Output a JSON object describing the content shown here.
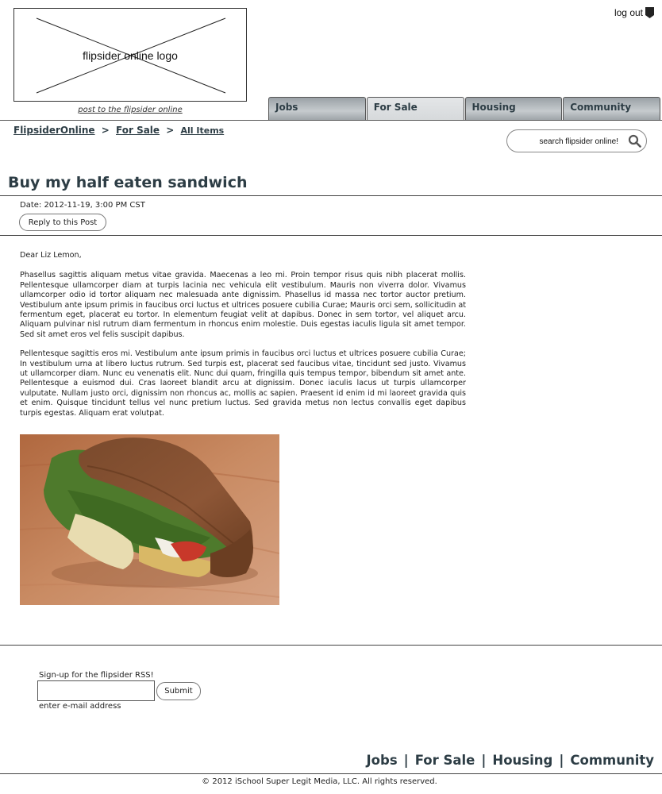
{
  "header": {
    "logo_text": "flipsider online logo",
    "logo_link": "post to the flipsider online",
    "logout_label": "log out"
  },
  "tabs": [
    {
      "label": "Jobs",
      "active": false
    },
    {
      "label": "For Sale",
      "active": true
    },
    {
      "label": "Housing",
      "active": false
    },
    {
      "label": "Community",
      "active": false
    }
  ],
  "breadcrumb": {
    "items": [
      "FlipsiderOnline",
      "For Sale",
      "All Items"
    ],
    "separator": ">"
  },
  "search": {
    "placeholder": "search flipsider online!",
    "icon": "search-icon"
  },
  "post": {
    "title": "Buy my half eaten sandwich",
    "date": "Date: 2012-11-19, 3:00 PM CST",
    "reply_label": "Reply to this Post",
    "greeting": "Dear Liz Lemon,",
    "paragraphs": [
      "Phasellus sagittis aliquam metus vitae gravida. Maecenas a leo mi. Proin tempor risus quis nibh placerat mollis. Pellentesque ullamcorper diam at turpis lacinia nec vehicula elit vestibulum. Mauris non viverra dolor. Vivamus ullamcorper odio id tortor aliquam nec malesuada ante dignissim. Phasellus id massa nec tortor auctor pretium. Vestibulum ante ipsum primis in faucibus orci luctus et ultrices posuere cubilia Curae; Mauris orci sem, sollicitudin at fermentum eget, placerat eu tortor. In elementum feugiat velit at dapibus. Donec in sem tortor, vel aliquet arcu. Aliquam pulvinar nisl rutrum diam fermentum in rhoncus enim molestie. Duis egestas iaculis ligula sit amet tempor. Sed sit amet eros vel felis suscipit dapibus.",
      "Pellentesque sagittis eros mi. Vestibulum ante ipsum primis in faucibus orci luctus et ultrices posuere cubilia Curae; In vestibulum urna at libero luctus rutrum. Sed turpis est, placerat sed faucibus vitae, tincidunt sed justo. Vivamus ut ullamcorper diam. Nunc eu venenatis elit. Nunc dui quam, fringilla quis tempus tempor, bibendum sit amet ante. Pellentesque a euismod dui. Cras laoreet blandit arcu at dignissim. Donec iaculis lacus ut turpis ullamcorper vulputate. Nullam justo orci, dignissim non rhoncus ac, mollis ac sapien. Praesent id enim id mi laoreet gravida quis et enim. Quisque tincidunt tellus vel nunc pretium luctus. Sed gravida metus non lectus convallis eget dapibus turpis egestas. Aliquam erat volutpat."
    ]
  },
  "rss": {
    "label": "Sign-up for the flipsider RSS!",
    "input_value": "",
    "submit_label": "Submit",
    "hint": "enter e-mail address"
  },
  "footer": {
    "nav": [
      "Jobs",
      "For Sale",
      "Housing",
      "Community"
    ],
    "separator": "|",
    "copyright": "© 2012 iSchool Super Legit Media, LLC. All rights reserved."
  },
  "colors": {
    "heading": "#2d3d45",
    "tab_inactive": "#b4babd",
    "tab_active": "#dcdfe1"
  }
}
